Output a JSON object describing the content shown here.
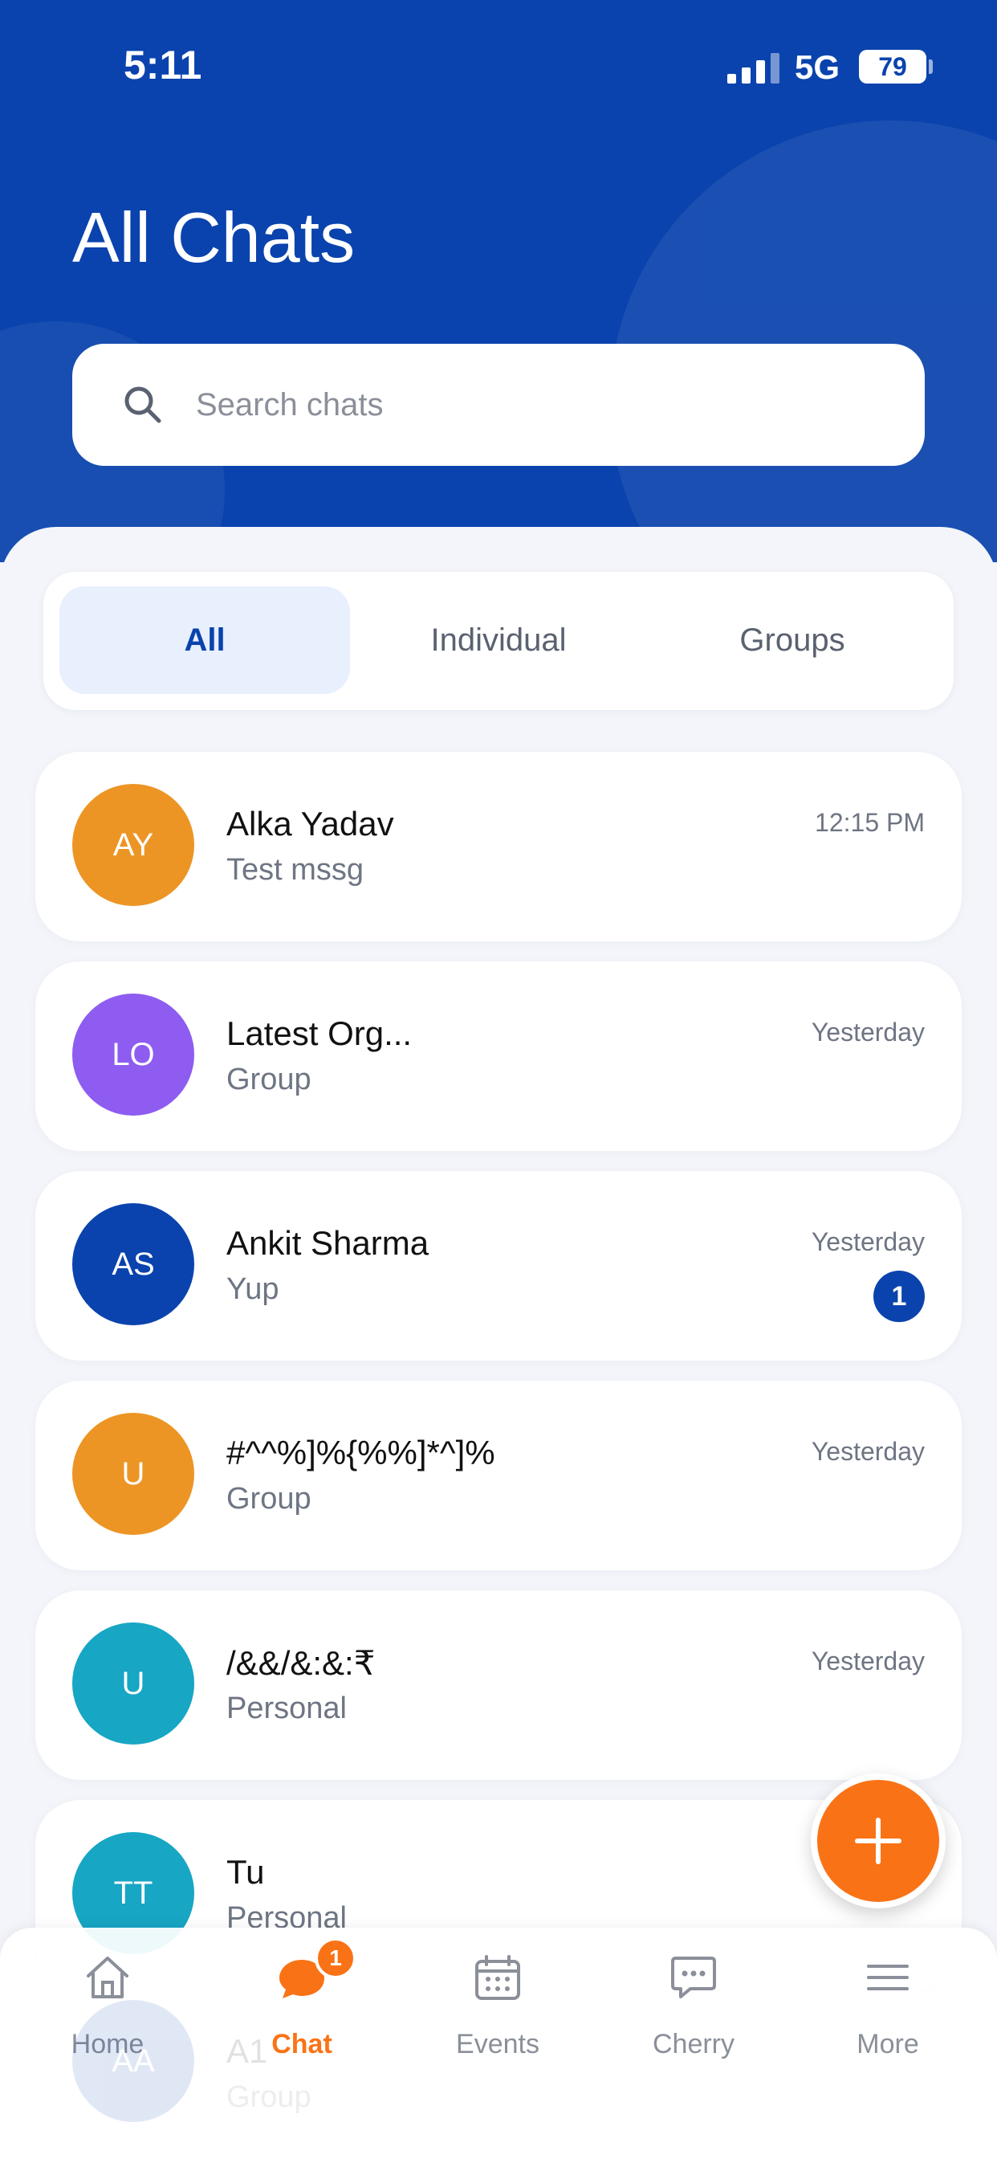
{
  "status_bar": {
    "time": "5:11",
    "network": "5G",
    "battery": "79"
  },
  "header": {
    "title": "All Chats"
  },
  "search": {
    "placeholder": "Search chats",
    "value": "",
    "icon": "search-icon"
  },
  "tabs": [
    {
      "label": "All",
      "active": true
    },
    {
      "label": "Individual",
      "active": false
    },
    {
      "label": "Groups",
      "active": false
    }
  ],
  "chats": [
    {
      "initials": "AY",
      "name": "Alka Yadav",
      "subtitle": "Test mssg",
      "time": "12:15 PM",
      "avatar_color": "#ec9525"
    },
    {
      "initials": "LO",
      "name": "Latest Org...",
      "subtitle": "Group",
      "time": "Yesterday",
      "avatar_color": "#8e5cf0"
    },
    {
      "initials": "AS",
      "name": "Ankit Sharma",
      "subtitle": "Yup",
      "time": "Yesterday",
      "unread": "1",
      "avatar_color": "#0a43ad"
    },
    {
      "initials": "U",
      "name": "#^^%]%{%%]*^]%",
      "subtitle": "Group",
      "time": "Yesterday",
      "avatar_color": "#ec9525"
    },
    {
      "initials": "U",
      "name": "/&&/&:&:₹",
      "subtitle": "Personal",
      "time": "Yesterday",
      "avatar_color": "#17a6c4"
    },
    {
      "initials": "TT",
      "name": "Tu",
      "subtitle": "Personal",
      "time": "",
      "avatar_color": "#17a6c4"
    }
  ],
  "ghost_chat": {
    "initials": "AA",
    "name": "A1",
    "subtitle": "Group"
  },
  "fab": {
    "icon": "plus-icon",
    "color": "#f97316"
  },
  "bottom_nav": [
    {
      "label": "Home",
      "icon": "home-icon",
      "active": false
    },
    {
      "label": "Chat",
      "icon": "chat-bubble-icon",
      "active": true,
      "badge": "1"
    },
    {
      "label": "Events",
      "icon": "calendar-icon",
      "active": false
    },
    {
      "label": "Cherry",
      "icon": "message-dots-icon",
      "active": false
    },
    {
      "label": "More",
      "icon": "menu-icon",
      "active": false
    }
  ],
  "colors": {
    "brand_blue": "#0a43ad",
    "accent_orange": "#f97316"
  }
}
